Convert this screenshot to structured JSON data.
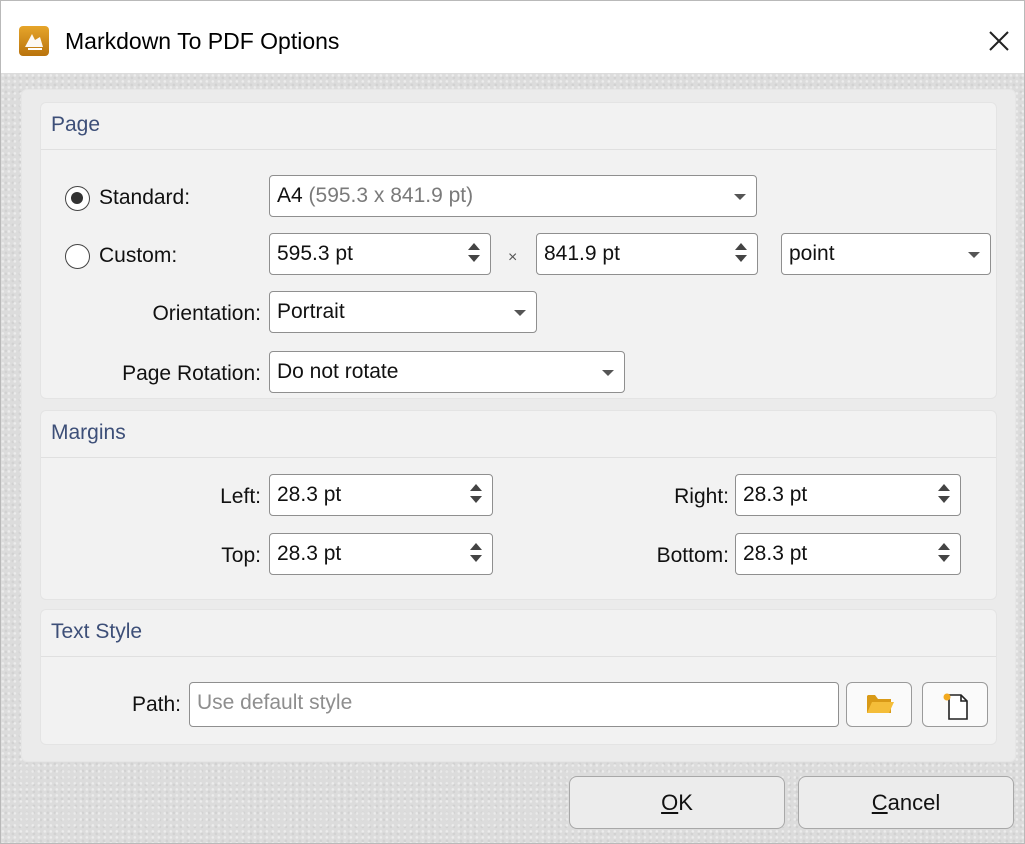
{
  "window": {
    "title": "Markdown To PDF Options",
    "app_icon": "pdf-editor-app-icon",
    "close_icon": "close-icon"
  },
  "page_group": {
    "title": "Page",
    "standard_label": "Standard:",
    "standard_selected": true,
    "standard_value_main": "A4",
    "standard_value_detail": "(595.3 x 841.9 pt)",
    "custom_label": "Custom:",
    "custom_selected": false,
    "width": "595.3 pt",
    "times": "×",
    "height": "841.9 pt",
    "unit": "point",
    "orientation_label": "Orientation:",
    "orientation": "Portrait",
    "rotation_label": "Page Rotation:",
    "rotation": "Do not rotate"
  },
  "margins_group": {
    "title": "Margins",
    "left_label": "Left:",
    "left": "28.3 pt",
    "right_label": "Right:",
    "right": "28.3 pt",
    "top_label": "Top:",
    "top": "28.3 pt",
    "bottom_label": "Bottom:",
    "bottom": "28.3 pt"
  },
  "text_style_group": {
    "title": "Text Style",
    "path_label": "Path:",
    "path_placeholder": "Use default style",
    "browse_icon": "folder-open-icon",
    "new_icon": "new-file-icon"
  },
  "buttons": {
    "ok_mnemonic": "O",
    "ok_rest": "K",
    "cancel_mnemonic": "C",
    "cancel_rest": "ancel"
  }
}
